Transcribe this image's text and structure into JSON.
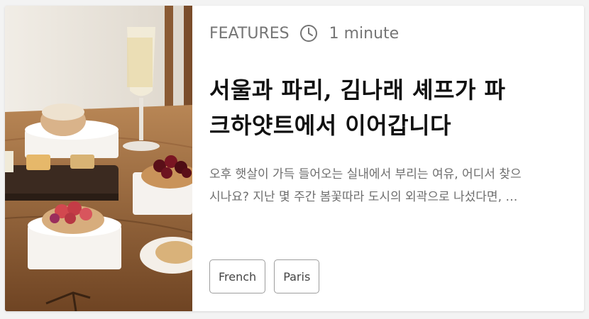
{
  "card": {
    "category": "FEATURES",
    "read_time": "1 minute",
    "title_line1": "서울과 파리, 김나래 셰프가 파",
    "title_line2": "크하얏트에서 이어갑니다",
    "excerpt_line1": "오후 햇살이 가득 들어오는 실내에서 부리는 여유, 어디서 찾으",
    "excerpt_line2": "시나요? 지난 몇 주간 봄꽃따라 도시의 외곽으로 나섰다면, …",
    "tags": [
      "French",
      "Paris"
    ],
    "clock_icon": "clock-icon",
    "accent_text_color": "#757575",
    "title_color": "#111111"
  }
}
